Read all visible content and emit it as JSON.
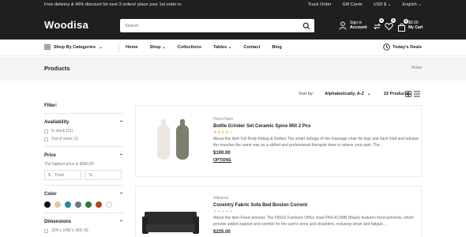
{
  "topbar": {
    "promo": "Free delivery & 40% discount for next 3 orders! place your 1st order in.",
    "links": [
      "Track Order",
      "Gift Cards",
      "USD $",
      "English"
    ]
  },
  "header": {
    "logo": "Woodisa",
    "search_placeholder": "Search",
    "account_line1": "Sign in",
    "account_line2": "Account",
    "compare_count": "0",
    "wishlist_count": "0",
    "cart_count": "0",
    "cart_amount": "$0.00",
    "cart_label": "My Cart"
  },
  "nav": {
    "category_label": "Shop By Categories",
    "items": [
      "Home",
      "Shop",
      "Collections",
      "Tables",
      "Contact",
      "Blog"
    ],
    "deals": "Today's Deals"
  },
  "page": {
    "title": "Products",
    "breadcrumb": "Home"
  },
  "toolbar": {
    "sort_label": "Sort by:",
    "sort_value": "Alphabetically, A-Z",
    "product_count": "22 Products"
  },
  "sidebar": {
    "filter_title": "Filter:",
    "availability": {
      "title": "Availability",
      "options": [
        "In stock (21)",
        "Out of stock (1)"
      ]
    },
    "price": {
      "title": "Price",
      "note": "The highest price is $380.00",
      "from_currency": "$",
      "from_placeholder": "From",
      "to_placeholder": "To"
    },
    "color": {
      "title": "Color",
      "swatches": [
        "#111111",
        "#e6c79b",
        "#1e8c9e",
        "#6b7a83",
        "#2a7d2e",
        "#b8421e",
        "#ffffff"
      ]
    },
    "dimensions": {
      "title": "Dimensions",
      "options": [
        "32H x 14W x 16D (4)"
      ]
    }
  },
  "products": [
    {
      "brand": "HomeTown",
      "name": "Bottle Grinder Set Ceramic Spice Mill 2 Pcs",
      "stars": "★★★★☆",
      "description": "About this item Full Body Airbag & Rollers The smart airbags of the massage chair for legs and back hold and release the muscles the same way as a skilled and professional therapist does to relieve your pain. The...",
      "price": "$100.00",
      "action": "OPTIONS"
    },
    {
      "brand": "Nilkamal",
      "name": "Coventry Fabric Sofa Bed Boston Current",
      "stars": "★★★★★",
      "description": "About this item Fixed armrest: The FINSS Furniture Office chair FNS-613MB (Black) features fixed armrests, which provide added support and comfort for the user's arms and shoulders, reducing strain and fatigue...",
      "price": "$225.00"
    }
  ]
}
